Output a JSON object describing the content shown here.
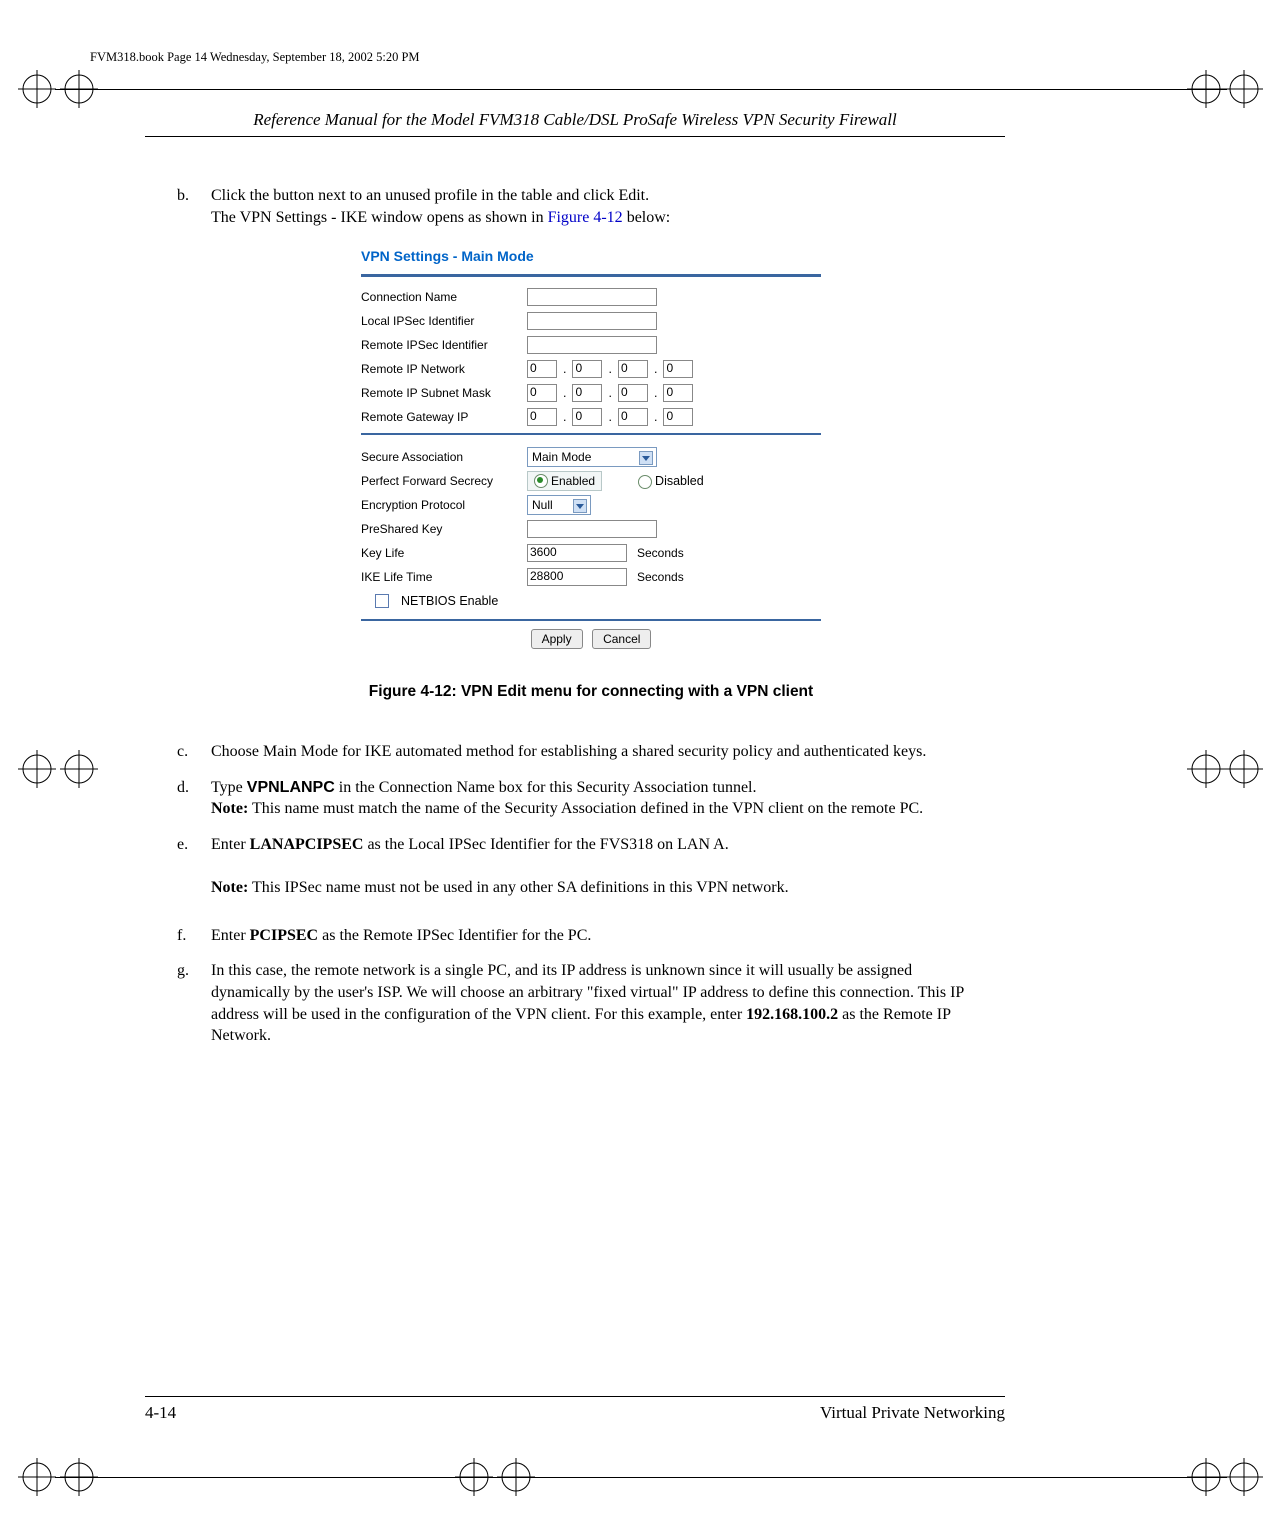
{
  "print_tag": "FVM318.book  Page 14  Wednesday, September 18, 2002  5:20 PM",
  "running_header": "Reference Manual for the Model FVM318 Cable/DSL ProSafe Wireless VPN Security Firewall",
  "items": {
    "b": {
      "marker": "b.",
      "line1": "Click the button next to an unused profile in the table and click Edit.",
      "line2_a": "The VPN Settings - IKE window opens as shown in ",
      "line2_ref": "Figure 4-12",
      "line2_b": " below:"
    },
    "c": {
      "marker": "c.",
      "text": "Choose Main Mode for IKE automated method for establishing a shared security policy and authenticated keys."
    },
    "d": {
      "marker": "d.",
      "pre": "Type ",
      "val": "VPNLANPC",
      "post": " in the Connection Name box for this Security Association tunnel.",
      "note_label": "Note:",
      "note": " This name must match the name of the Security Association defined in the VPN client on the remote PC."
    },
    "e": {
      "marker": "e.",
      "pre": "Enter ",
      "val": "LANAPCIPSEC",
      "post": " as the Local IPSec Identifier for the FVS318 on LAN A.",
      "note_label": "Note:",
      "note": " This IPSec name must not be used in any other SA definitions in this VPN network."
    },
    "f": {
      "marker": "f.",
      "pre": "Enter ",
      "val": "PCIPSEC",
      "post": " as the Remote IPSec Identifier for the PC."
    },
    "g": {
      "marker": "g.",
      "pre": "In this case, the remote network is a single PC, and its IP address is unknown since it will usually be assigned dynamically by the user's ISP. We will choose an arbitrary \"fixed virtual\" IP address to define this connection. This IP address will be used in the configuration of the VPN client. For this example, enter ",
      "val": "192.168.100.2",
      "post": " as the Remote IP Network."
    }
  },
  "figure": {
    "title": "VPN Settings - Main Mode",
    "labels": {
      "conn": "Connection Name",
      "local_id": "Local IPSec Identifier",
      "remote_id": "Remote IPSec Identifier",
      "remote_net": "Remote IP Network",
      "remote_mask": "Remote IP Subnet Mask",
      "remote_gw": "Remote Gateway IP",
      "sa": "Secure Association",
      "pfs": "Perfect Forward Secrecy",
      "enc": "Encryption Protocol",
      "psk": "PreShared Key",
      "keylife": "Key Life",
      "ikelife": "IKE Life Time",
      "netbios": "NETBIOS Enable"
    },
    "values": {
      "ip_octet": "0",
      "sa_mode": "Main Mode",
      "pfs_enabled": "Enabled",
      "pfs_disabled": "Disabled",
      "enc_val": "Null",
      "keylife": "3600",
      "ikelife": "28800",
      "seconds": "Seconds"
    },
    "buttons": {
      "apply": "Apply",
      "cancel": "Cancel"
    },
    "caption": "Figure 4-12:  VPN Edit menu for connecting with a VPN client"
  },
  "footer": {
    "page": "4-14",
    "section": "Virtual Private Networking"
  }
}
